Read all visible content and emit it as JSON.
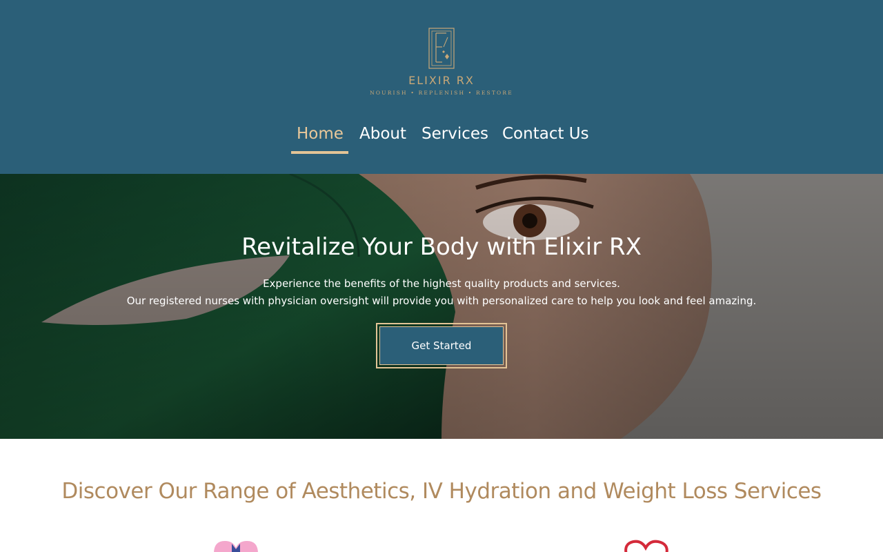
{
  "brand": {
    "name": "ELIXIR RX",
    "tagline": "NOURISH • REPLENISH • RESTORE",
    "logo_icon": "elixir-monogram-icon"
  },
  "nav": {
    "items": [
      {
        "label": "Home",
        "active": true
      },
      {
        "label": "About",
        "active": false
      },
      {
        "label": "Services",
        "active": false
      },
      {
        "label": "Contact Us",
        "active": false
      }
    ]
  },
  "hero": {
    "title": "Revitalize Your Body with Elixir RX",
    "line1": "Experience the benefits of the highest quality products and services.",
    "line2": "Our registered nurses with physician oversight will provide you with personalized care to help you look and feel amazing.",
    "cta_label": "Get Started"
  },
  "services": {
    "title": "Discover Our Range of Aesthetics, IV Hydration and Weight Loss Services",
    "icons": [
      "heart-lips-icon",
      "heart-outline-icon"
    ]
  },
  "colors": {
    "header_bg": "#2b5f78",
    "accent_gold": "#c9a877",
    "nav_active": "#e9c89a",
    "section_title": "#b08a5e"
  }
}
